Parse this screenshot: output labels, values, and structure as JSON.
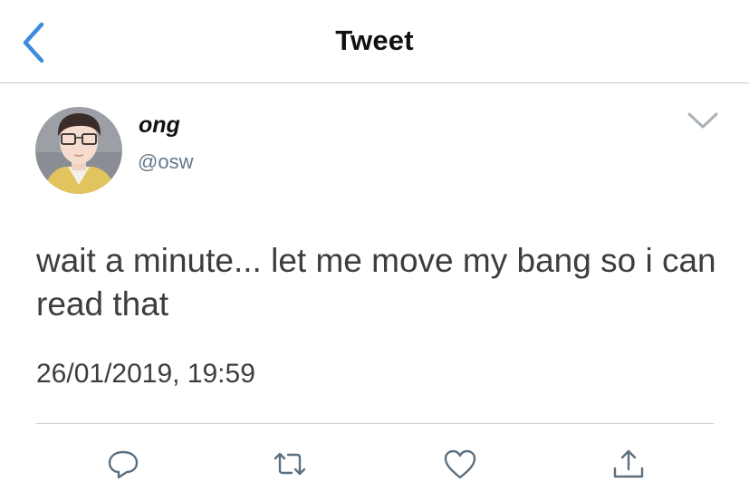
{
  "nav": {
    "title": "Tweet",
    "back_icon": "chevron-left-icon"
  },
  "colors": {
    "accent": "#3b8ce0",
    "text_primary": "#111111",
    "text_secondary": "#657786",
    "tweet_text": "#3d3d3d",
    "icon_gray": "#5b6f7f"
  },
  "tweet": {
    "author": {
      "display_name": "ong",
      "handle": "@osw"
    },
    "text": "wait a minute... let me move my bang so i can read that",
    "timestamp": "26/01/2019, 19:59",
    "menu_icon": "chevron-down-icon"
  },
  "actions": [
    {
      "name": "reply",
      "icon": "reply-icon"
    },
    {
      "name": "retweet",
      "icon": "retweet-icon"
    },
    {
      "name": "like",
      "icon": "heart-icon"
    },
    {
      "name": "share",
      "icon": "share-icon"
    }
  ]
}
